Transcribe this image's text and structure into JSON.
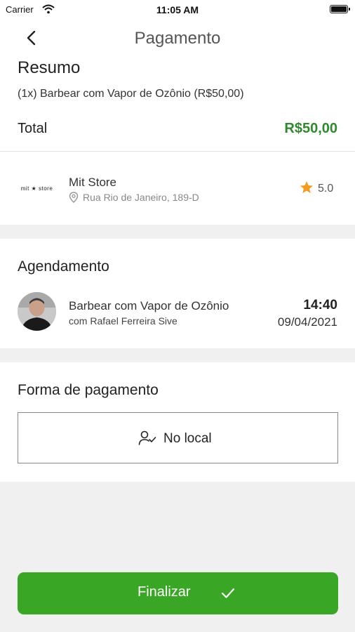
{
  "status_bar": {
    "carrier": "Carrier",
    "time": "11:05 AM"
  },
  "nav": {
    "title": "Pagamento",
    "back_icon": "chevron-left-icon"
  },
  "summary": {
    "title": "Resumo",
    "line": "(1x) Barbear com Vapor de Ozônio (R$50,00)",
    "total_label": "Total",
    "total_value": "R$50,00"
  },
  "store": {
    "logo_text": "mit ★ store",
    "name": "Mit Store",
    "address": "Rua Rio de Janeiro, 189-D",
    "rating": "5.0"
  },
  "schedule": {
    "title": "Agendamento",
    "service": "Barbear com Vapor de Ozônio",
    "professional": "com Rafael Ferreira Sive",
    "time": "14:40",
    "date": "09/04/2021"
  },
  "payment": {
    "title": "Forma de pagamento",
    "option_label": "No local",
    "option_icon": "user-check-icon"
  },
  "finish": {
    "label": "Finalizar"
  },
  "colors": {
    "accent_green": "#3aa625",
    "total_green": "#2f8a2f",
    "star": "#f59a23",
    "background": "#f0f0f0"
  }
}
